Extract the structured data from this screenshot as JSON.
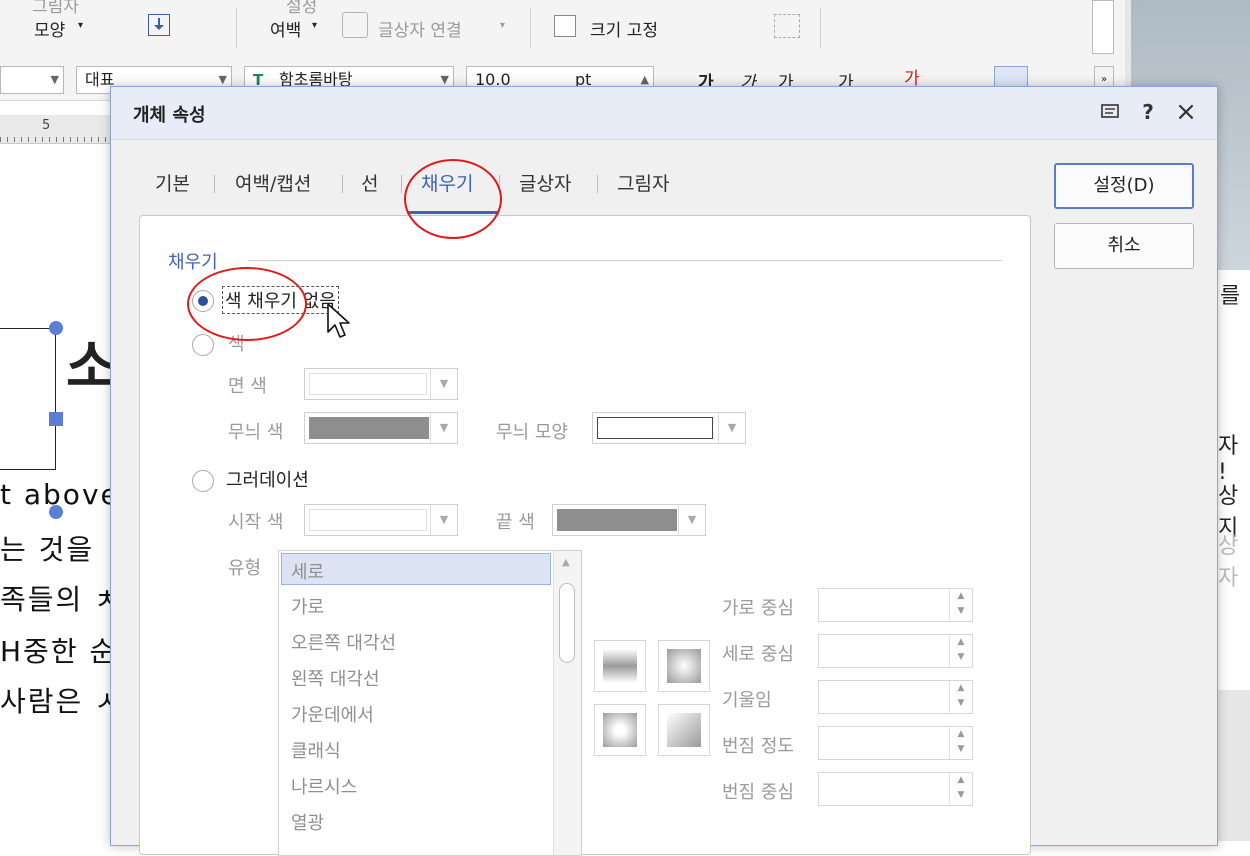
{
  "toolbar": {
    "shape_label_top": "그림자",
    "shape_label": "모양",
    "margin_label_top": "설정",
    "margin_label": "여백",
    "text_link": "글상자 연결",
    "fixed_size": "크기 고정",
    "style_combo": "대표",
    "font_combo": "함초롬바탕",
    "size_combo": "10.0",
    "size_unit": "pt",
    "font_btns": [
      "가",
      "가",
      "가",
      "가",
      "가"
    ]
  },
  "ruler": {
    "tick_label": "5"
  },
  "document": {
    "big_char": "소",
    "lines": [
      "t above",
      "는 것을",
      "족들의 ㅊ",
      "H중한 순",
      "사람은 ㅅ"
    ]
  },
  "right_panel": {
    "lines": [
      "를",
      "자 !",
      "상지",
      "상자"
    ]
  },
  "dialog": {
    "title": "개체 속성",
    "help": "?",
    "close": "×",
    "tabs": [
      "기본",
      "여백/캡션",
      "선",
      "채우기",
      "글상자",
      "그림자"
    ],
    "active_tab": "채우기",
    "ok_button": "설정(D)",
    "cancel_button": "취소",
    "section_title": "채우기",
    "options": {
      "no_fill": "색 채우기 없음",
      "color": "색",
      "gradient": "그러데이션"
    },
    "fields": {
      "face_color": "면 색",
      "pattern_color": "무늬 색",
      "pattern_shape": "무늬 모양",
      "start_color": "시작 색",
      "end_color": "끝 색",
      "type": "유형",
      "h_center": "가로 중심",
      "v_center": "세로 중심",
      "tilt": "기울임",
      "blur_degree": "번짐 정도",
      "blur_center": "번짐 중심"
    },
    "gradient_types": [
      "세로",
      "가로",
      "오른쪽 대각선",
      "왼쪽 대각선",
      "가운데에서",
      "클래식",
      "나르시스",
      "열광"
    ],
    "selected_type": "세로"
  },
  "colors": {
    "accent": "#3f63b6",
    "annotation": "#e01a1a",
    "swatch_gray": "#8e8e8e"
  }
}
